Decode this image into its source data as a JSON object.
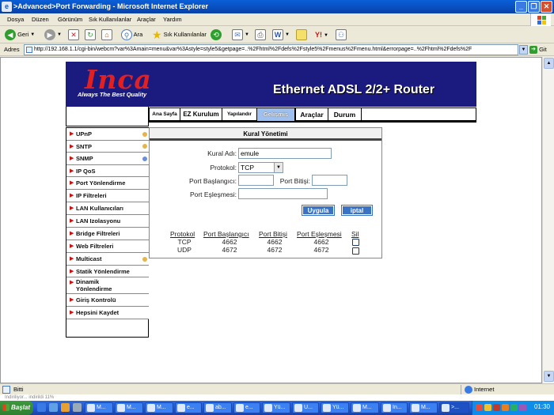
{
  "window": {
    "title": ">Advanced>Port Forwarding - Microsoft Internet Explorer"
  },
  "menubar": [
    "Dosya",
    "Düzen",
    "Görünüm",
    "Sık Kullanılanlar",
    "Araçlar",
    "Yardım"
  ],
  "toolbar": {
    "back_label": "Geri",
    "search_label": "Ara",
    "favorites_label": "Sık Kullanılanlar"
  },
  "address": {
    "label": "Adres",
    "url": "http://192.168.1.1/cgi-bin/webcm?var%3Amain=menu&var%3Astyle=style5&getpage=..%2Fhtml%2Fdefs%2Fstyle5%2Fmenus%2Fmenu.html&errorpage=..%2Fhtml%2Fdefs%2F",
    "go_label": "Git"
  },
  "banner": {
    "logo": "Inca",
    "tagline": "Always The Best Quality",
    "product": "Ethernet ADSL 2/2+ Router"
  },
  "nav": {
    "tabs": [
      "Ana Sayfa",
      "EZ Kurulum",
      "Yapılandır",
      "Gelişmiş",
      "Araçlar",
      "Durum"
    ],
    "active": "Gelişmiş"
  },
  "sidebar": {
    "items": [
      "UPnP",
      "SNTP",
      "SNMP",
      "IP QoS",
      "Port Yönlendirme",
      "IP Filtreleri",
      "LAN Kullanıcıları",
      "LAN Izolasyonu",
      "Bridge Filtreleri",
      "Web Filtreleri",
      "Multicast",
      "Statik Yönlendirme",
      "Dinamik Yönlendirme",
      "Giriş Kontrolü",
      "Hepsini Kaydet"
    ]
  },
  "form": {
    "title": "Kural Yönetimi",
    "rule_name_label": "Kural Adı:",
    "rule_name_value": "emule",
    "protocol_label": "Protokol:",
    "protocol_value": "TCP",
    "port_start_label": "Port Başlangıcı:",
    "port_start_value": "",
    "port_end_label": "Port Bitişi:",
    "port_end_value": "",
    "port_map_label": "Port Eşleşmesi:",
    "port_map_value": "",
    "apply_label": "Uygula",
    "cancel_label": "iptal"
  },
  "rules": {
    "headers": [
      "Protokol",
      "Port Başlangıcı",
      "Port Bitişi",
      "Port Eşleşmesi",
      "Sil"
    ],
    "rows": [
      [
        "TCP",
        "4662",
        "4662",
        "4662"
      ],
      [
        "UDP",
        "4672",
        "4672",
        "4672"
      ]
    ]
  },
  "statusbar": {
    "status": "Bitti",
    "zone": "Internet",
    "background_text": "Indiriliyor... indirildi 11%"
  },
  "taskbar": {
    "start_label": "Başlat",
    "tasks": [
      "M...",
      "M...",
      "M...",
      "e...",
      "ab...",
      "e...",
      "Yü...",
      "U...",
      "Yü...",
      "M...",
      "In...",
      "M...",
      ">..."
    ],
    "clock": "01:30"
  },
  "colors": {
    "banner_bg": "#1b1b7f",
    "logo_red": "#e32020",
    "active_tab": "#9fc0ee",
    "button_blue": "#3b73c4",
    "xp_titlebar": "#0a5fd8"
  }
}
